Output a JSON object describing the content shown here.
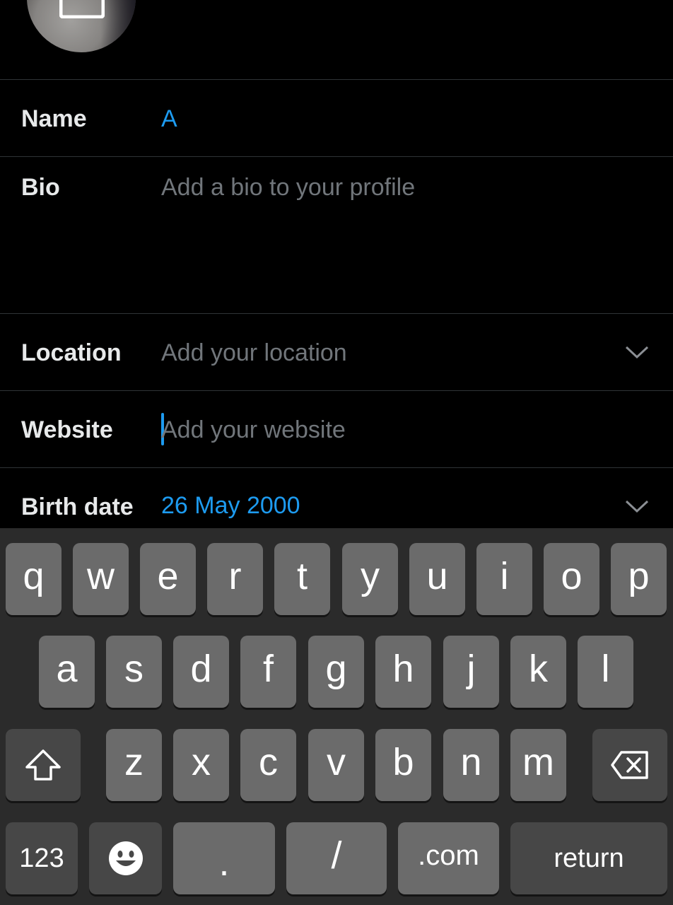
{
  "form": {
    "name": {
      "label": "Name",
      "value": "A"
    },
    "bio": {
      "label": "Bio",
      "placeholder": "Add a bio to your profile"
    },
    "location": {
      "label": "Location",
      "placeholder": "Add your location"
    },
    "website": {
      "label": "Website",
      "placeholder": "Add your website"
    },
    "birth_date": {
      "label": "Birth date",
      "value": "26 May 2000"
    }
  },
  "keyboard": {
    "row1": [
      "q",
      "w",
      "e",
      "r",
      "t",
      "y",
      "u",
      "i",
      "o",
      "p"
    ],
    "row2": [
      "a",
      "s",
      "d",
      "f",
      "g",
      "h",
      "j",
      "k",
      "l"
    ],
    "row3": [
      "z",
      "x",
      "c",
      "v",
      "b",
      "n",
      "m"
    ],
    "numbers_key": "123",
    "period_key": ".",
    "slash_key": "/",
    "dotcom_key": ".com",
    "return_key": "return",
    "shift_icon": "shift-arrow-up-icon",
    "delete_icon": "backspace-icon",
    "emoji_icon": "smiley-face-icon"
  },
  "colors": {
    "accent": "#1d9bf0",
    "placeholder": "#71767b",
    "background": "#000000",
    "keyboard_bg": "#2b2b2b"
  }
}
